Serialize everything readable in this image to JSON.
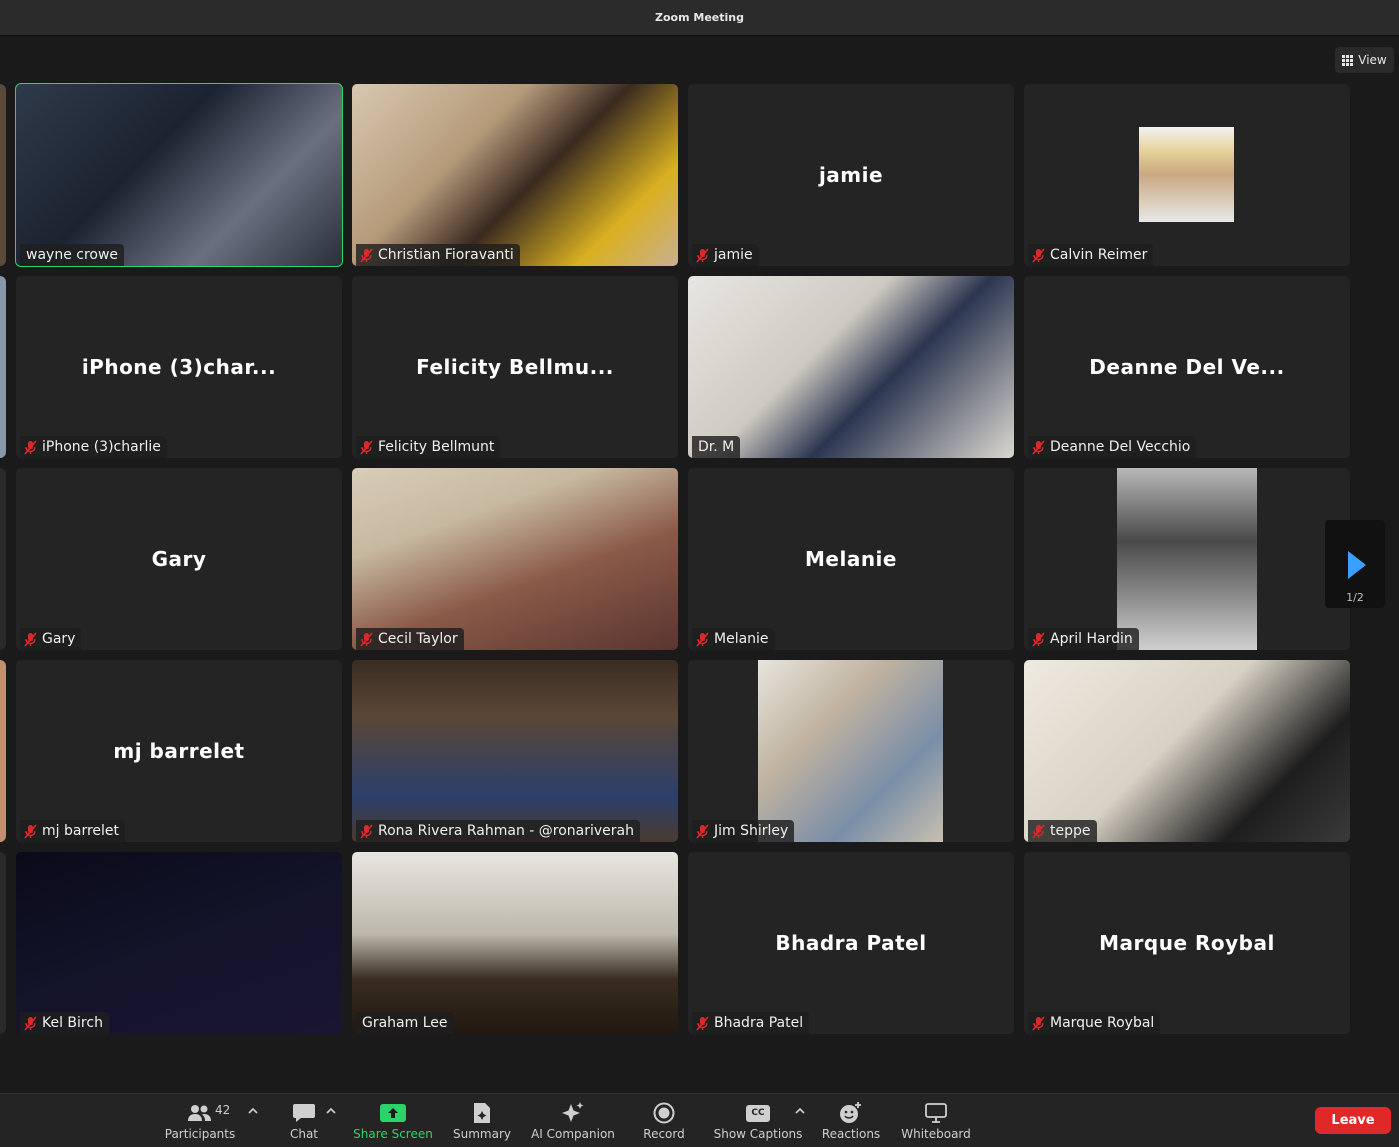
{
  "window": {
    "title": "Zoom Meeting"
  },
  "view_button": {
    "label": "View"
  },
  "pager": {
    "label": "1/2"
  },
  "colors": {
    "active_speaker": "#2ad46a",
    "leave": "#e02828",
    "muted": "#e02828",
    "share": "#2ad46a",
    "pager_arrow": "#3aa0ff"
  },
  "tiles": [
    {
      "name": "wayne crowe",
      "big": "",
      "muted": false,
      "video": true,
      "active": true
    },
    {
      "name": "Christian Fioravanti",
      "big": "",
      "muted": true,
      "video": true,
      "active": false
    },
    {
      "name": "jamie",
      "big": "jamie",
      "muted": true,
      "video": false,
      "active": false
    },
    {
      "name": "Calvin Reimer",
      "big": "",
      "muted": true,
      "video": false,
      "avatar": true,
      "active": false
    },
    {
      "name": "iPhone (3)charlie",
      "big": "iPhone (3)char...",
      "muted": true,
      "video": false,
      "active": false
    },
    {
      "name": "Felicity Bellmunt",
      "big": "Felicity Bellmu...",
      "muted": true,
      "video": false,
      "active": false
    },
    {
      "name": "Dr. M",
      "big": "",
      "muted": false,
      "video": true,
      "active": false
    },
    {
      "name": "Deanne Del Vecchio",
      "big": "Deanne Del Ve...",
      "muted": true,
      "video": false,
      "active": false
    },
    {
      "name": "Gary",
      "big": "Gary",
      "muted": true,
      "video": false,
      "active": false
    },
    {
      "name": "Cecil Taylor",
      "big": "",
      "muted": true,
      "video": true,
      "active": false
    },
    {
      "name": "Melanie",
      "big": "Melanie",
      "muted": true,
      "video": false,
      "active": false
    },
    {
      "name": "April Hardin",
      "big": "",
      "muted": true,
      "video": true,
      "active": false
    },
    {
      "name": "mj barrelet",
      "big": "mj barrelet",
      "muted": true,
      "video": false,
      "active": false
    },
    {
      "name": "Rona Rivera Rahman - @ronariverah",
      "big": "",
      "muted": true,
      "video": true,
      "active": false
    },
    {
      "name": "Jim Shirley",
      "big": "",
      "muted": true,
      "video": true,
      "active": false
    },
    {
      "name": "teppe",
      "big": "",
      "muted": true,
      "video": true,
      "active": false
    },
    {
      "name": "Kel Birch",
      "big": "",
      "muted": true,
      "video": true,
      "active": false
    },
    {
      "name": "Graham Lee",
      "big": "",
      "muted": false,
      "video": true,
      "active": false
    },
    {
      "name": "Bhadra Patel",
      "big": "Bhadra Patel",
      "muted": true,
      "video": false,
      "active": false
    },
    {
      "name": "Marque Roybal",
      "big": "Marque Roybal",
      "muted": true,
      "video": false,
      "active": false
    }
  ],
  "toolbar": {
    "participants_label": "Participants",
    "participants_count": "42",
    "chat_label": "Chat",
    "share_label": "Share Screen",
    "summary_label": "Summary",
    "ai_label": "AI Companion",
    "record_label": "Record",
    "captions_label": "Show Captions",
    "cc_text": "CC",
    "reactions_label": "Reactions",
    "whiteboard_label": "Whiteboard",
    "leave_label": "Leave"
  }
}
